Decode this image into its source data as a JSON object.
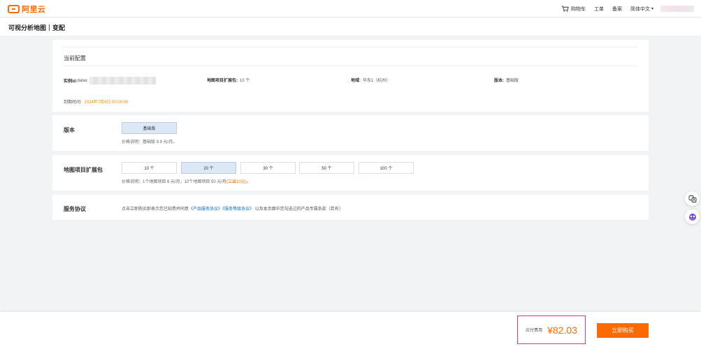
{
  "header": {
    "logo_text": "阿里云",
    "nav": {
      "cart": "购物车",
      "ticket": "工单",
      "record": "备案",
      "language": "简体中文"
    }
  },
  "page": {
    "title": "可视分析地图｜变配"
  },
  "current_config": {
    "title": "当前配置",
    "instance_label": "实例id:",
    "instance_value": "datav",
    "map_pkg_label": "地图项目扩展包:",
    "map_pkg_value": "10 个",
    "region_label": "地域:",
    "region_value": "华东1（杭州）",
    "version_label": "版本:",
    "version_value": "基础版",
    "expire_label": "到期时间:",
    "expire_value": "2024年7月9日 00:00:00"
  },
  "version_section": {
    "label": "版本",
    "options": [
      "基础版"
    ],
    "selected_index": 0,
    "hint": "价格说明：基础版 9.9 元/月。"
  },
  "map_pkg_section": {
    "label": "地图项目扩展包",
    "options": [
      "10 个",
      "20 个",
      "30 个",
      "50 个",
      "100 个"
    ],
    "selected_index": 1,
    "hint": "价格说明：1个地图项目 6 元/月，10个地图项目 50 元/月",
    "hint_save": "(立省10元)",
    "hint_end": "。"
  },
  "agreement_section": {
    "label": "服务协议",
    "text_before": "点击立即购买即表示您已知悉并同意",
    "link1": "《产品服务协议》",
    "link2": "《服务等级协议》",
    "text_after": "以及本页面中您勾选过的产品专属条款（若有）"
  },
  "footer": {
    "fee_label": "应付费用",
    "fee_amount": "¥82.03",
    "buy_label": "立即购买"
  },
  "icons": {
    "float_top": "translate-icon",
    "float_bottom": "ai-assistant-icon"
  },
  "colors": {
    "accent": "#ff6a00",
    "link": "#0070cc",
    "selected_bg": "#dde8f7",
    "highlight_border": "#e8347a"
  }
}
